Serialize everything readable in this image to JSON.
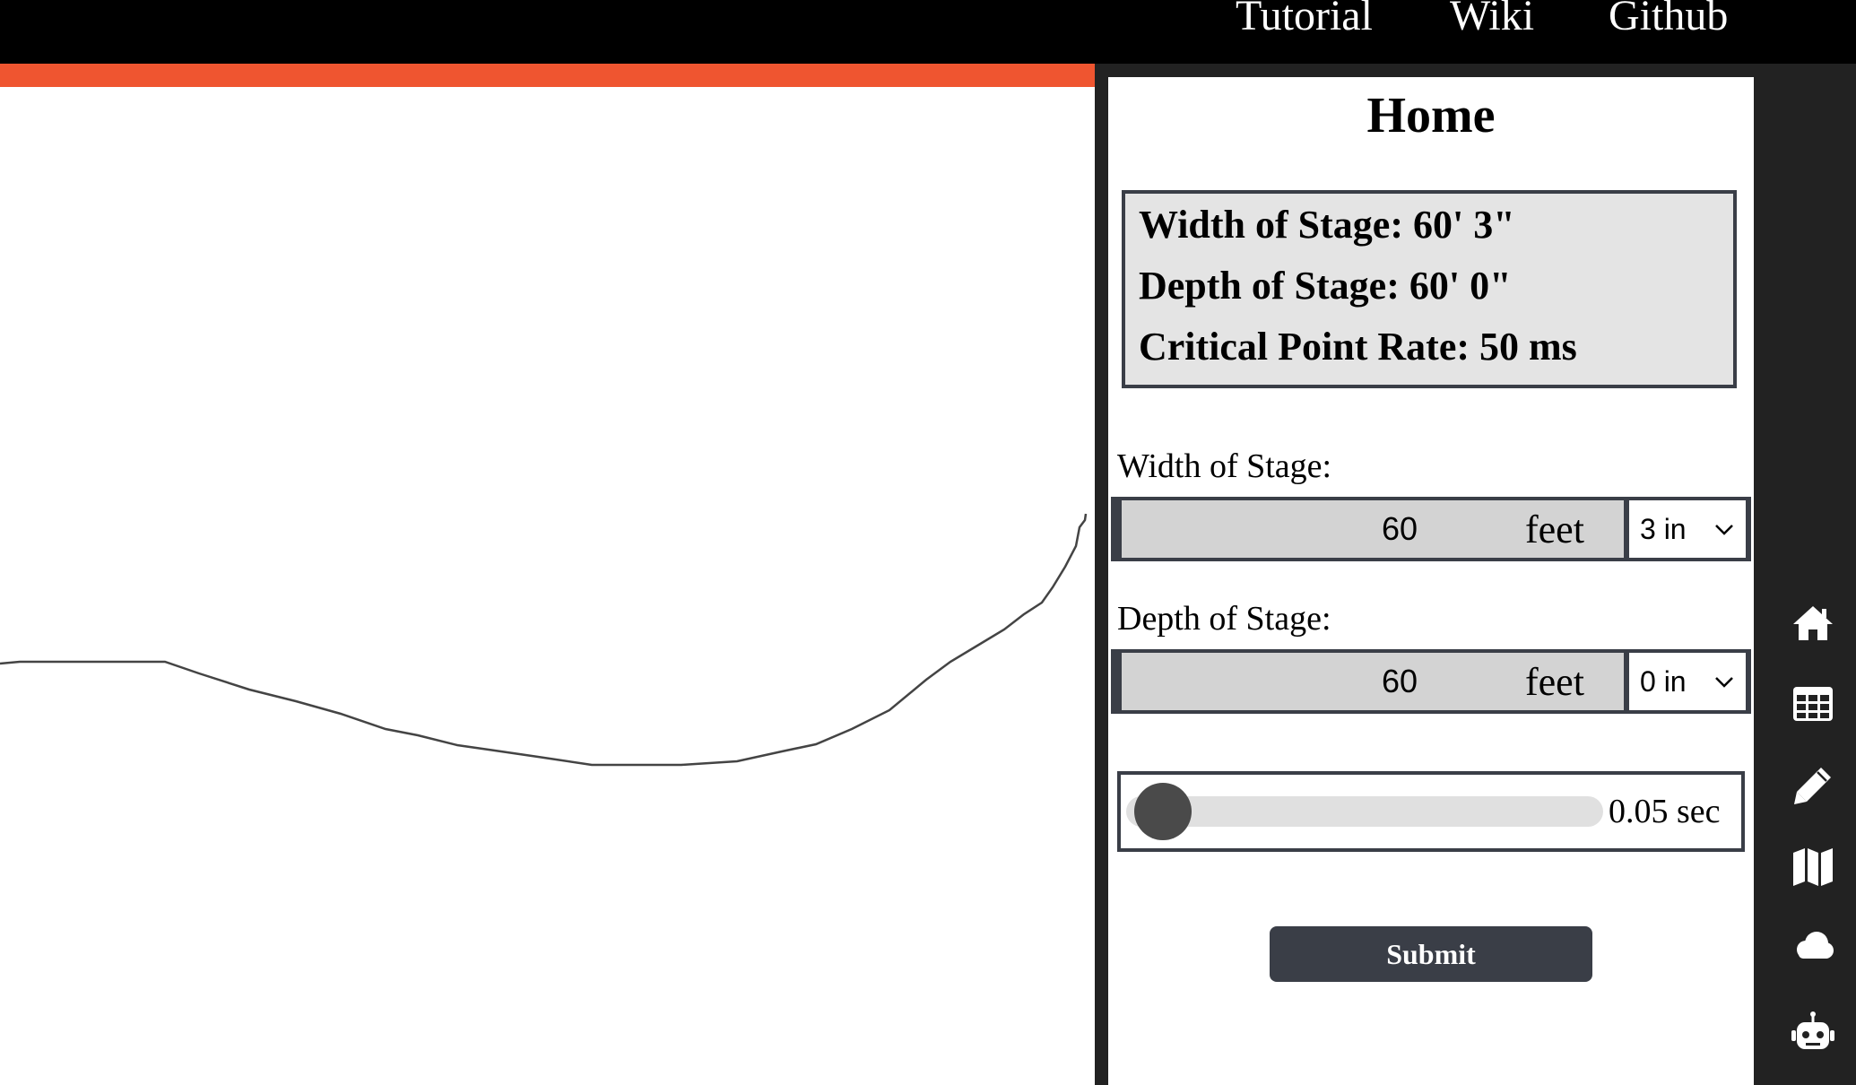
{
  "nav": {
    "tutorial": "Tutorial",
    "wiki": "Wiki",
    "github": "Github"
  },
  "colors": {
    "topbar": "#000000",
    "accent_bar": "#ef5530",
    "panel_frame": "#222222",
    "dark_slate": "#3a3e47",
    "info_bg": "#e4e4e4",
    "input_bg": "#d3d3d3"
  },
  "panel": {
    "title": "Home",
    "info": {
      "width_line": "Width of Stage: 60' 3\"",
      "depth_line": "Depth of Stage: 60' 0\"",
      "rate_line": "Critical Point Rate: 50 ms"
    },
    "width_field": {
      "label": "Width of Stage:",
      "feet_value": "60",
      "feet_unit": "feet",
      "inches_selected": "3 in"
    },
    "depth_field": {
      "label": "Depth of Stage:",
      "feet_value": "60",
      "feet_unit": "feet",
      "inches_selected": "0 in"
    },
    "rate_slider": {
      "value_text": "0.05 sec",
      "level": 0.05
    },
    "submit_label": "Submit"
  },
  "rail_icons": [
    "home-icon",
    "table-icon",
    "pencil-icon",
    "map-icon",
    "cloud-icon",
    "robot-icon"
  ]
}
